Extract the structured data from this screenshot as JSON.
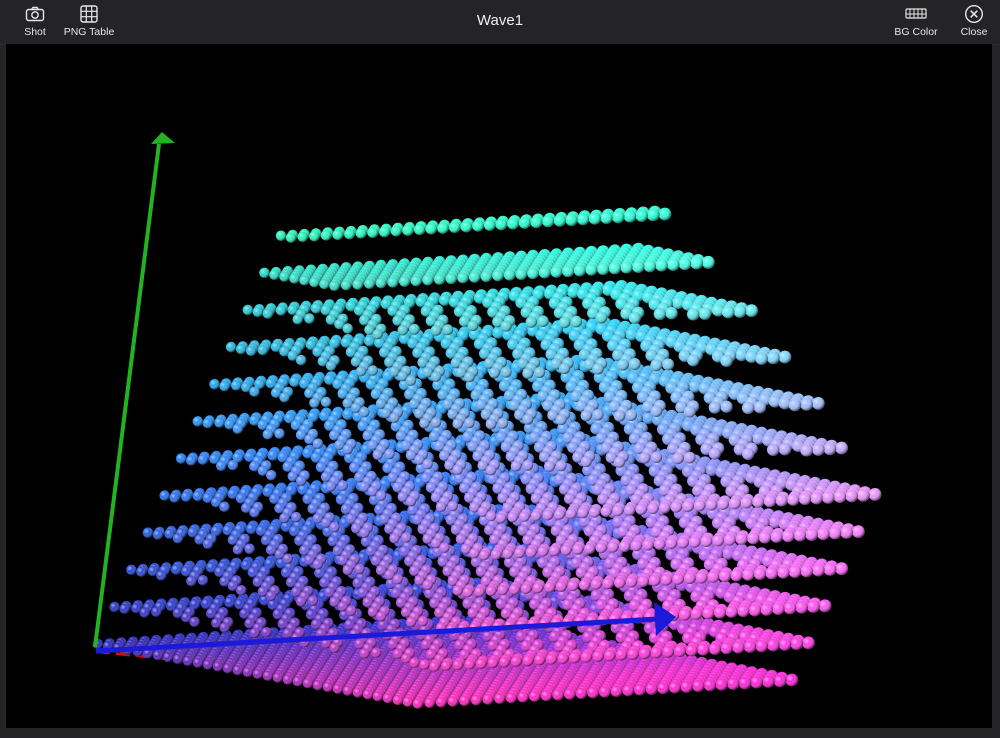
{
  "window": {
    "title": "Wave1"
  },
  "toolbar": {
    "shot_label": "Shot",
    "png_table_label": "PNG Table",
    "bg_color_label": "BG Color",
    "close_label": "Close"
  },
  "icons": {
    "shot": "camera-icon",
    "png_table": "grid-table-icon",
    "bg_color": "palette-keyboard-icon",
    "close": "close-circle-icon"
  },
  "colors": {
    "toolbar_bg": "#242426",
    "viewport_bg": "#000000",
    "axis_x": "#d01010",
    "axis_y": "#22b322",
    "axis_z": "#1a1ad8"
  }
}
